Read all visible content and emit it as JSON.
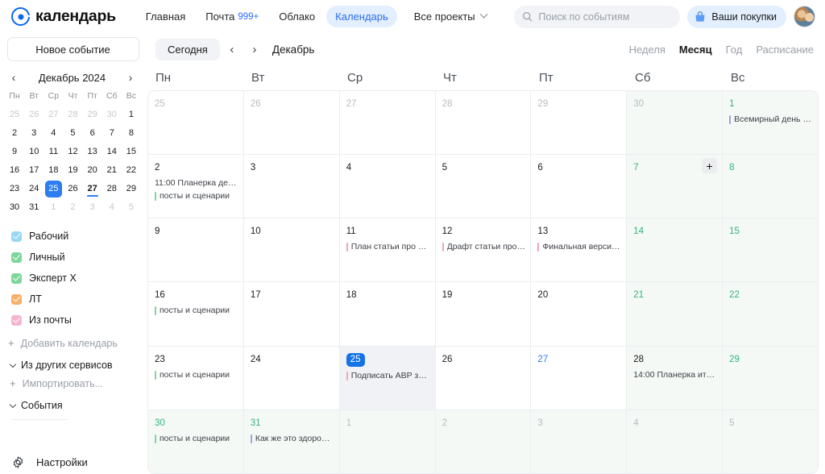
{
  "header": {
    "logo_text": "календарь",
    "nav": [
      {
        "label": "Главная",
        "active": false,
        "badge": ""
      },
      {
        "label": "Почта",
        "active": false,
        "badge": "999+"
      },
      {
        "label": "Облако",
        "active": false,
        "badge": ""
      },
      {
        "label": "Календарь",
        "active": true,
        "badge": ""
      }
    ],
    "projects_label": "Все проекты",
    "search_placeholder": "Поиск по событиям",
    "purchases_label": "Ваши покупки"
  },
  "toolbar": {
    "new_event_label": "Новое событие",
    "today_label": "Сегодня",
    "prev_label": "‹",
    "next_label": "›",
    "month_label": "Декабрь",
    "views": [
      {
        "label": "Неделя",
        "active": false
      },
      {
        "label": "Месяц",
        "active": true
      },
      {
        "label": "Год",
        "active": false
      },
      {
        "label": "Расписание",
        "active": false
      }
    ]
  },
  "sidebar": {
    "mini_calendar": {
      "title": "Декабрь 2024",
      "prev": "‹",
      "next": "›",
      "dow": [
        "Пн",
        "Вт",
        "Ср",
        "Чт",
        "Пт",
        "Сб",
        "Вс"
      ],
      "weeks": [
        [
          {
            "d": "25",
            "s": "muted"
          },
          {
            "d": "26",
            "s": "muted"
          },
          {
            "d": "27",
            "s": "muted"
          },
          {
            "d": "28",
            "s": "muted"
          },
          {
            "d": "29",
            "s": "muted"
          },
          {
            "d": "30",
            "s": "muted"
          },
          {
            "d": "1",
            "s": ""
          }
        ],
        [
          {
            "d": "2",
            "s": ""
          },
          {
            "d": "3",
            "s": ""
          },
          {
            "d": "4",
            "s": ""
          },
          {
            "d": "5",
            "s": ""
          },
          {
            "d": "6",
            "s": ""
          },
          {
            "d": "7",
            "s": ""
          },
          {
            "d": "8",
            "s": ""
          }
        ],
        [
          {
            "d": "9",
            "s": ""
          },
          {
            "d": "10",
            "s": ""
          },
          {
            "d": "11",
            "s": ""
          },
          {
            "d": "12",
            "s": ""
          },
          {
            "d": "13",
            "s": ""
          },
          {
            "d": "14",
            "s": ""
          },
          {
            "d": "15",
            "s": ""
          }
        ],
        [
          {
            "d": "16",
            "s": ""
          },
          {
            "d": "17",
            "s": ""
          },
          {
            "d": "18",
            "s": ""
          },
          {
            "d": "19",
            "s": ""
          },
          {
            "d": "20",
            "s": ""
          },
          {
            "d": "21",
            "s": ""
          },
          {
            "d": "22",
            "s": ""
          }
        ],
        [
          {
            "d": "23",
            "s": ""
          },
          {
            "d": "24",
            "s": ""
          },
          {
            "d": "25",
            "s": "today"
          },
          {
            "d": "26",
            "s": ""
          },
          {
            "d": "27",
            "s": "underline"
          },
          {
            "d": "28",
            "s": ""
          },
          {
            "d": "29",
            "s": ""
          }
        ],
        [
          {
            "d": "30",
            "s": ""
          },
          {
            "d": "31",
            "s": ""
          },
          {
            "d": "1",
            "s": "muted"
          },
          {
            "d": "2",
            "s": "muted"
          },
          {
            "d": "3",
            "s": "muted"
          },
          {
            "d": "4",
            "s": "muted"
          },
          {
            "d": "5",
            "s": "muted"
          }
        ]
      ]
    },
    "calendars": [
      {
        "label": "Рабочий",
        "color": "#9ad7f5"
      },
      {
        "label": "Личный",
        "color": "#7ed69a"
      },
      {
        "label": "Эксперт X",
        "color": "#7ed69a"
      },
      {
        "label": "ЛТ",
        "color": "#f7b06a"
      },
      {
        "label": "Из почты",
        "color": "#f5b3cf"
      }
    ],
    "add_calendar_label": "Добавить календарь",
    "add_icon": "+",
    "other_services_label": "Из других сервисов",
    "import_label": "Импортировать...",
    "events_section_label": "События",
    "settings_label": "Настройки"
  },
  "calendar": {
    "dow": [
      "Пн",
      "Вт",
      "Ср",
      "Чт",
      "Пт",
      "Сб",
      "Вс"
    ],
    "cells": [
      {
        "day": "25",
        "style": "muted",
        "weekend": false,
        "events": []
      },
      {
        "day": "26",
        "style": "muted",
        "weekend": false,
        "events": []
      },
      {
        "day": "27",
        "style": "muted",
        "weekend": false,
        "events": []
      },
      {
        "day": "28",
        "style": "muted",
        "weekend": false,
        "events": []
      },
      {
        "day": "29",
        "style": "muted",
        "weekend": false,
        "events": []
      },
      {
        "day": "30",
        "style": "muted",
        "weekend": true,
        "events": []
      },
      {
        "day": "1",
        "style": "green",
        "weekend": true,
        "events": [
          {
            "text": "Всемирный день бо...",
            "color": "#9aa8d8",
            "bar": true
          }
        ]
      },
      {
        "day": "2",
        "style": "",
        "weekend": false,
        "events": [
          {
            "text": "11:00 Планерка декаб...",
            "color": "",
            "bar": false
          },
          {
            "text": "посты и сценарии",
            "color": "#7ed69a",
            "bar": true
          }
        ]
      },
      {
        "day": "3",
        "style": "",
        "weekend": false,
        "events": []
      },
      {
        "day": "4",
        "style": "",
        "weekend": false,
        "events": []
      },
      {
        "day": "5",
        "style": "",
        "weekend": false,
        "events": []
      },
      {
        "day": "6",
        "style": "",
        "weekend": false,
        "events": []
      },
      {
        "day": "7",
        "style": "green",
        "weekend": true,
        "events": [],
        "plus": "+"
      },
      {
        "day": "8",
        "style": "green",
        "weekend": true,
        "events": []
      },
      {
        "day": "9",
        "style": "",
        "weekend": false,
        "events": []
      },
      {
        "day": "10",
        "style": "",
        "weekend": false,
        "events": []
      },
      {
        "day": "11",
        "style": "",
        "weekend": false,
        "events": [
          {
            "text": "План статьи про кал...",
            "color": "#e8a6b8",
            "bar": true
          }
        ]
      },
      {
        "day": "12",
        "style": "",
        "weekend": false,
        "events": [
          {
            "text": "Драфт статьи про ка...",
            "color": "#e8a6b8",
            "bar": true
          }
        ]
      },
      {
        "day": "13",
        "style": "",
        "weekend": false,
        "events": [
          {
            "text": "Финальная версия с...",
            "color": "#e8a6b8",
            "bar": true
          }
        ]
      },
      {
        "day": "14",
        "style": "green",
        "weekend": true,
        "events": []
      },
      {
        "day": "15",
        "style": "green",
        "weekend": true,
        "events": []
      },
      {
        "day": "16",
        "style": "",
        "weekend": false,
        "events": [
          {
            "text": "посты и сценарии",
            "color": "#7ed69a",
            "bar": true
          }
        ]
      },
      {
        "day": "17",
        "style": "",
        "weekend": false,
        "events": []
      },
      {
        "day": "18",
        "style": "",
        "weekend": false,
        "events": []
      },
      {
        "day": "19",
        "style": "",
        "weekend": false,
        "events": []
      },
      {
        "day": "20",
        "style": "",
        "weekend": false,
        "events": []
      },
      {
        "day": "21",
        "style": "green",
        "weekend": true,
        "events": []
      },
      {
        "day": "22",
        "style": "green",
        "weekend": true,
        "events": []
      },
      {
        "day": "23",
        "style": "",
        "weekend": false,
        "events": [
          {
            "text": "посты и сценарии",
            "color": "#7ed69a",
            "bar": true
          }
        ]
      },
      {
        "day": "24",
        "style": "",
        "weekend": false,
        "events": []
      },
      {
        "day": "25",
        "style": "today",
        "weekend": false,
        "selected": true,
        "events": [
          {
            "text": "Подписать АВР за де...",
            "color": "#f0a8b8",
            "bar": true
          }
        ]
      },
      {
        "day": "26",
        "style": "",
        "weekend": false,
        "events": []
      },
      {
        "day": "27",
        "style": "blue",
        "weekend": false,
        "events": []
      },
      {
        "day": "28",
        "style": "",
        "weekend": true,
        "events": [
          {
            "text": "14:00 Планерка итог...",
            "color": "",
            "bar": false
          }
        ]
      },
      {
        "day": "29",
        "style": "green",
        "weekend": true,
        "events": []
      },
      {
        "day": "30",
        "style": "green",
        "weekend": true,
        "events": [
          {
            "text": "посты и сценарии",
            "color": "#7ed69a",
            "bar": true
          }
        ]
      },
      {
        "day": "31",
        "style": "green",
        "weekend": true,
        "events": [
          {
            "text": "Как же это здорово ...",
            "color": "#9aa8d8",
            "bar": true
          }
        ]
      },
      {
        "day": "1",
        "style": "muted",
        "weekend": true,
        "events": []
      },
      {
        "day": "2",
        "style": "muted",
        "weekend": true,
        "events": []
      },
      {
        "day": "3",
        "style": "muted",
        "weekend": true,
        "events": []
      },
      {
        "day": "4",
        "style": "muted",
        "weekend": true,
        "events": []
      },
      {
        "day": "5",
        "style": "muted",
        "weekend": true,
        "events": []
      }
    ]
  }
}
